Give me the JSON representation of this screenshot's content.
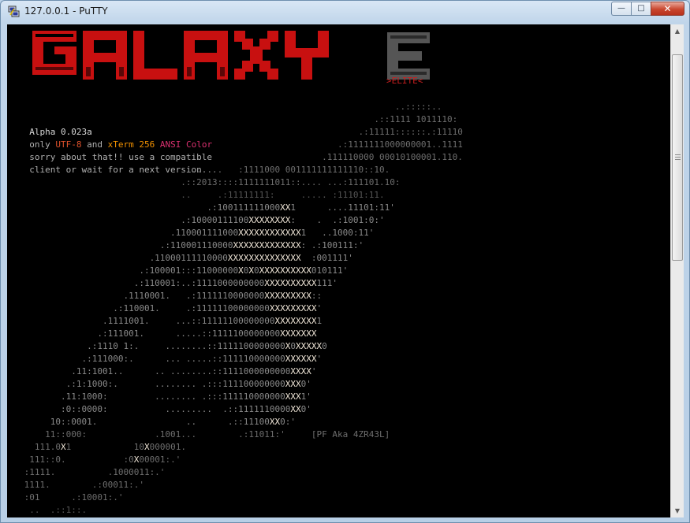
{
  "window": {
    "title": "127.0.0.1 - PuTTY",
    "icon": "putty-icon",
    "controls": [
      "minimize-icon",
      "maximize-icon",
      "close-icon"
    ]
  },
  "banner": {
    "logo_text": "GALAXY",
    "logo_letter": "E",
    "logo_color": "#c81010",
    "letter_color": "#555555",
    "tag": ">ELITE<"
  },
  "info": {
    "version": "Alpha 0.023a",
    "line2_prefix": "only ",
    "utf": "UTF-8",
    "line2_and": " and ",
    "xterm": "xTerm 256",
    "ansi": " ANSI Color",
    "line3": "sorry about that!! use a compatible",
    "line4": "client or wait for a next version..."
  },
  "art_lines": [
    [
      "c3",
      "                                                                        ..:::::.."
    ],
    [
      "c3",
      "                                                                    .::1111 1011110:"
    ],
    [
      "c3",
      "                                                                 .:11111::::::.:11110"
    ],
    [
      "c3",
      "                                                             .:1111111000000001..1111"
    ],
    [
      "c3",
      "                                                          .111110000 00010100001.110."
    ],
    [
      "c3",
      "                                 ......   :1111000 001111111111110::10."
    ],
    [
      "c3",
      "                               .::2013::::1111111011::.... ...:111101.10:"
    ],
    [
      "c2",
      "                               ..     .:11111111:     ..... :11101:11."
    ],
    [
      "c4",
      "                                    .:100111111000XX1      ....11101:11'"
    ],
    [
      "c4",
      "                               .:10000111100XXXXXXXX:    .  .:1001:0:'"
    ],
    [
      "c4",
      "                             .110001111000XXXXXXXXXXXX1   ..1000:11'"
    ],
    [
      "c4",
      "                           .:110001110000XXXXXXXXXXXXX: .:100111:'"
    ],
    [
      "c4",
      "                         .11000111110000XXXXXXXXXXXXXX  :001111'"
    ],
    [
      "c4",
      "                       .:100001:::11000000X0X0XXXXXXXXXX010111'"
    ],
    [
      "c4",
      "                      .:110001:..:1111000000000XXXXXXXXXX111'"
    ],
    [
      "c4",
      "                    .1110001.   .:1111110000000XXXXXXXXX::"
    ],
    [
      "c4",
      "                  .:110001.     .:11111100000000XXXXXXXXX'"
    ],
    [
      "c4",
      "                .1111001.     ...::11111100000000XXXXXXXX1"
    ],
    [
      "c4",
      "               .:111001.      .....::1111100000000XXXXXXX"
    ],
    [
      "c4",
      "             .:1110 1:.     ........::1111100000000X0XXXXX0"
    ],
    [
      "c4",
      "            .:111000:.      ... .....::111110000000XXXXXX'"
    ],
    [
      "c4",
      "          .11:1001..      .. ........::1111000000000XXXX'"
    ],
    [
      "c4",
      "         .:1:1000:.       ........ .:::111100000000XXX0'"
    ],
    [
      "c4",
      "        .11:1000:         ........ .:::111110000000XXX1'"
    ],
    [
      "c4",
      "        :0::0000:           .........  .::1111110000XX0'"
    ],
    [
      "c4",
      "      10::0001.                 ..      .::11100XX0:'"
    ],
    [
      "c3",
      "     11::000:             .1001...        .:11011:'     [PF Aka 4ZR43L]"
    ],
    [
      "c3",
      "   111.0X1            10X000001."
    ],
    [
      "c3",
      "  111::0.           :0X00001:.'"
    ],
    [
      "c3",
      " :1111.          .1000011:.'"
    ],
    [
      "c3",
      " 1111.        .:00011:.'"
    ],
    [
      "c3",
      " :01      .:10001:.'"
    ],
    [
      "c2",
      "  ..  .::1::."
    ]
  ]
}
